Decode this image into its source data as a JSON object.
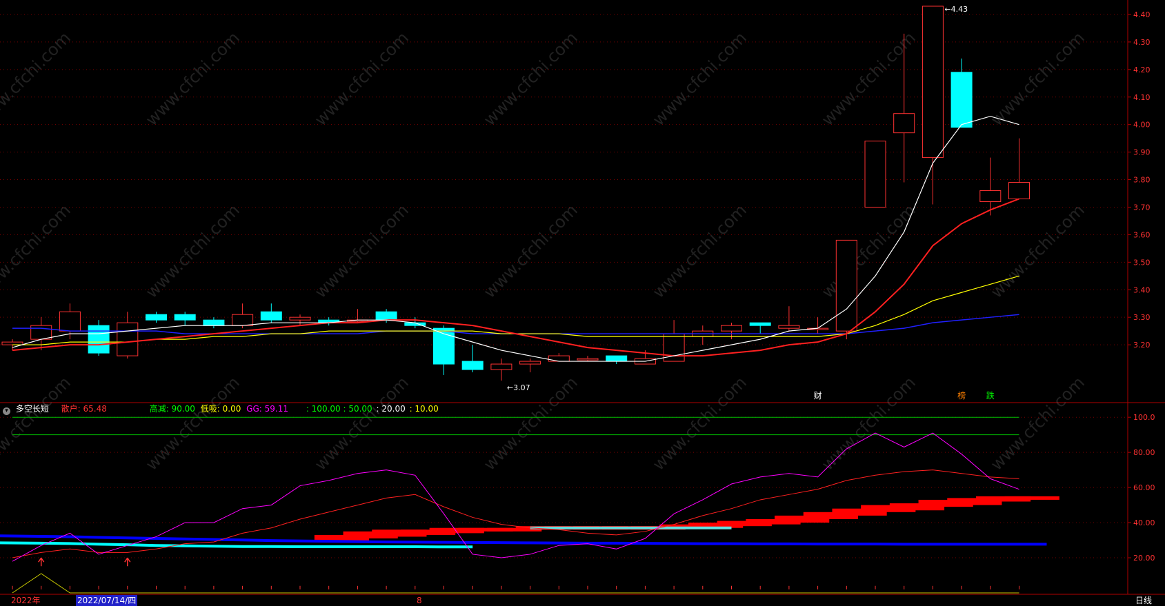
{
  "price_panel": {
    "price_axis": [
      "4.40",
      "4.30",
      "4.20",
      "4.10",
      "4.00",
      "3.90",
      "3.80",
      "3.70",
      "3.60",
      "3.50",
      "3.40",
      "3.30",
      "3.20"
    ],
    "high_label": "4.43",
    "low_label": "3.07",
    "high_marker": "←4.43",
    "low_marker": "←3.07",
    "event_marks": [
      {
        "text": "财",
        "color": "#ffffff",
        "day": 28
      },
      {
        "text": "榜",
        "color": "#ff8000",
        "day": 33
      },
      {
        "text": "跌",
        "color": "#00ff00",
        "day": 34
      }
    ],
    "watermark": "www.cfchi.com"
  },
  "indicator_panel": {
    "title": "多空长短",
    "sanhu": "散户: 65.48",
    "gaojian": "高减: 90.00",
    "dixi": "低吸: 0.00",
    "gg": "GG: 59.11",
    "levels": ": 100.00 : 50.00",
    "levels2": ": 20.00",
    "levels3": ": 10.00",
    "axis": [
      "100.0",
      "80.00",
      "60.00",
      "40.00",
      "20.00"
    ]
  },
  "footer": {
    "year": "2022年",
    "date": "2022/07/14/四",
    "marker": "8",
    "period": "日线"
  },
  "colors": {
    "up": "#ff3232",
    "down": "#00ffff",
    "ma5": "#ffffff",
    "ma10": "#ff2020",
    "ma20": "#ffff00",
    "ma60": "#2020ff",
    "grid": "#7a0000",
    "magenta": "#ff00ff"
  },
  "chart_data": {
    "type": "candlestick",
    "price_range": [
      3.04,
      4.44
    ],
    "candles": [
      {
        "o": 3.2,
        "h": 3.22,
        "l": 3.18,
        "c": 3.21
      },
      {
        "o": 3.22,
        "h": 3.3,
        "l": 3.18,
        "c": 3.27
      },
      {
        "o": 3.25,
        "h": 3.35,
        "l": 3.22,
        "c": 3.32
      },
      {
        "o": 3.27,
        "h": 3.29,
        "l": 3.16,
        "c": 3.17
      },
      {
        "o": 3.16,
        "h": 3.32,
        "l": 3.15,
        "c": 3.28
      },
      {
        "o": 3.31,
        "h": 3.32,
        "l": 3.28,
        "c": 3.29
      },
      {
        "o": 3.31,
        "h": 3.32,
        "l": 3.27,
        "c": 3.29
      },
      {
        "o": 3.29,
        "h": 3.3,
        "l": 3.26,
        "c": 3.27
      },
      {
        "o": 3.27,
        "h": 3.35,
        "l": 3.26,
        "c": 3.31
      },
      {
        "o": 3.32,
        "h": 3.35,
        "l": 3.28,
        "c": 3.29
      },
      {
        "o": 3.29,
        "h": 3.31,
        "l": 3.27,
        "c": 3.3
      },
      {
        "o": 3.29,
        "h": 3.3,
        "l": 3.27,
        "c": 3.28
      },
      {
        "o": 3.29,
        "h": 3.33,
        "l": 3.28,
        "c": 3.29
      },
      {
        "o": 3.32,
        "h": 3.33,
        "l": 3.28,
        "c": 3.29
      },
      {
        "o": 3.28,
        "h": 3.3,
        "l": 3.26,
        "c": 3.27
      },
      {
        "o": 3.26,
        "h": 3.27,
        "l": 3.09,
        "c": 3.13
      },
      {
        "o": 3.14,
        "h": 3.2,
        "l": 3.1,
        "c": 3.11
      },
      {
        "o": 3.11,
        "h": 3.15,
        "l": 3.07,
        "c": 3.13
      },
      {
        "o": 3.13,
        "h": 3.15,
        "l": 3.1,
        "c": 3.14
      },
      {
        "o": 3.14,
        "h": 3.17,
        "l": 3.14,
        "c": 3.16
      },
      {
        "o": 3.15,
        "h": 3.16,
        "l": 3.14,
        "c": 3.15
      },
      {
        "o": 3.16,
        "h": 3.16,
        "l": 3.13,
        "c": 3.14
      },
      {
        "o": 3.13,
        "h": 3.18,
        "l": 3.13,
        "c": 3.15
      },
      {
        "o": 3.14,
        "h": 3.29,
        "l": 3.15,
        "c": 3.24
      },
      {
        "o": 3.23,
        "h": 3.27,
        "l": 3.2,
        "c": 3.25
      },
      {
        "o": 3.25,
        "h": 3.28,
        "l": 3.22,
        "c": 3.27
      },
      {
        "o": 3.28,
        "h": 3.28,
        "l": 3.24,
        "c": 3.27
      },
      {
        "o": 3.26,
        "h": 3.34,
        "l": 3.25,
        "c": 3.27
      },
      {
        "o": 3.26,
        "h": 3.3,
        "l": 3.24,
        "c": 3.26
      },
      {
        "o": 3.25,
        "h": 3.58,
        "l": 3.22,
        "c": 3.58
      },
      {
        "o": 3.7,
        "h": 3.94,
        "l": 3.7,
        "c": 3.94
      },
      {
        "o": 3.97,
        "h": 4.33,
        "l": 3.79,
        "c": 4.04
      },
      {
        "o": 3.88,
        "h": 4.43,
        "l": 3.71,
        "c": 4.43
      },
      {
        "o": 4.19,
        "h": 4.24,
        "l": 3.99,
        "c": 3.99
      },
      {
        "o": 3.72,
        "h": 3.88,
        "l": 3.67,
        "c": 3.76
      },
      {
        "o": 3.73,
        "h": 3.95,
        "l": 3.73,
        "c": 3.79
      }
    ],
    "ma5": [
      3.19,
      3.22,
      3.24,
      3.24,
      3.25,
      3.26,
      3.27,
      3.27,
      3.27,
      3.28,
      3.28,
      3.28,
      3.29,
      3.29,
      3.28,
      3.24,
      3.21,
      3.18,
      3.16,
      3.14,
      3.14,
      3.14,
      3.14,
      3.16,
      3.18,
      3.2,
      3.22,
      3.25,
      3.26,
      3.33,
      3.45,
      3.61,
      3.86,
      4.0,
      4.03,
      4.0
    ],
    "ma10": [
      3.18,
      3.19,
      3.2,
      3.2,
      3.21,
      3.22,
      3.23,
      3.24,
      3.25,
      3.26,
      3.27,
      3.28,
      3.28,
      3.29,
      3.29,
      3.28,
      3.27,
      3.25,
      3.23,
      3.21,
      3.19,
      3.18,
      3.17,
      3.16,
      3.16,
      3.17,
      3.18,
      3.2,
      3.21,
      3.24,
      3.32,
      3.42,
      3.56,
      3.64,
      3.69,
      3.73
    ],
    "ma20": [
      3.2,
      3.2,
      3.21,
      3.21,
      3.21,
      3.22,
      3.22,
      3.23,
      3.23,
      3.24,
      3.24,
      3.25,
      3.25,
      3.25,
      3.25,
      3.25,
      3.25,
      3.24,
      3.24,
      3.24,
      3.23,
      3.23,
      3.23,
      3.23,
      3.23,
      3.23,
      3.23,
      3.23,
      3.23,
      3.24,
      3.27,
      3.31,
      3.36,
      3.39,
      3.42,
      3.45
    ],
    "ma60": [
      3.26,
      3.26,
      3.25,
      3.25,
      3.25,
      3.25,
      3.24,
      3.24,
      3.24,
      3.24,
      3.24,
      3.24,
      3.24,
      3.25,
      3.25,
      3.25,
      3.24,
      3.24,
      3.24,
      3.24,
      3.24,
      3.24,
      3.24,
      3.24,
      3.24,
      3.24,
      3.24,
      3.24,
      3.24,
      3.24,
      3.25,
      3.26,
      3.28,
      3.29,
      3.3,
      3.31
    ],
    "indicator": {
      "range": [
        0,
        104
      ],
      "magenta": [
        18,
        27,
        34,
        22,
        27,
        32,
        40,
        40,
        48,
        50,
        61,
        64,
        68,
        70,
        67,
        45,
        22,
        20,
        22,
        27,
        28,
        25,
        31,
        45,
        53,
        62,
        66,
        68,
        66,
        82,
        91,
        83,
        91,
        79,
        65,
        59
      ],
      "red": [
        20,
        23,
        25,
        23,
        23,
        25,
        28,
        29,
        34,
        37,
        42,
        46,
        50,
        54,
        56,
        49,
        43,
        39,
        37,
        36,
        34,
        33,
        35,
        39,
        44,
        48,
        53,
        56,
        59,
        64,
        67,
        69,
        70,
        68,
        66,
        65
      ],
      "blue": [
        32.5,
        32.2,
        32,
        31.6,
        31.3,
        31,
        30.7,
        30.4,
        30.1,
        29.8,
        29.6,
        29.4,
        29.2,
        29,
        28.9,
        28.8,
        28.7,
        28.6,
        28.5,
        28.4,
        28.3,
        28.3,
        28.2,
        28.1,
        28,
        28,
        27.9,
        27.9,
        27.8,
        27.8,
        27.8,
        27.7,
        27.7,
        27.7,
        27.7,
        27.7
      ],
      "cyan": [
        28.5,
        28.3,
        28.1,
        27.7,
        27.4,
        27,
        26.8,
        26.6,
        26.4,
        26.4,
        26.3,
        26.3,
        26.3,
        26.3,
        26.3,
        26.2,
        26.2
      ],
      "red_bars": [
        [
          12,
          29,
          33
        ],
        [
          13,
          31,
          35
        ],
        [
          14,
          32,
          36
        ],
        [
          15,
          33,
          36
        ],
        [
          16,
          34,
          37
        ],
        [
          17,
          35,
          37
        ],
        [
          18,
          35,
          37
        ],
        [
          19,
          36,
          38
        ],
        [
          20,
          36,
          38
        ],
        [
          21,
          36,
          38
        ],
        [
          22,
          36,
          38
        ],
        [
          23,
          36,
          38
        ],
        [
          24,
          37,
          39
        ],
        [
          25,
          37,
          40
        ],
        [
          26,
          38,
          41
        ],
        [
          27,
          39,
          42
        ],
        [
          28,
          40,
          44
        ],
        [
          29,
          42,
          46
        ],
        [
          30,
          44,
          48
        ],
        [
          31,
          46,
          50
        ],
        [
          32,
          47,
          51
        ],
        [
          33,
          49,
          53
        ],
        [
          34,
          50,
          54
        ],
        [
          35,
          52,
          55
        ],
        [
          36,
          53,
          55
        ]
      ],
      "arrows": [
        1,
        4
      ],
      "yellow": [
        7,
        11,
        0,
        0,
        0
      ]
    }
  }
}
